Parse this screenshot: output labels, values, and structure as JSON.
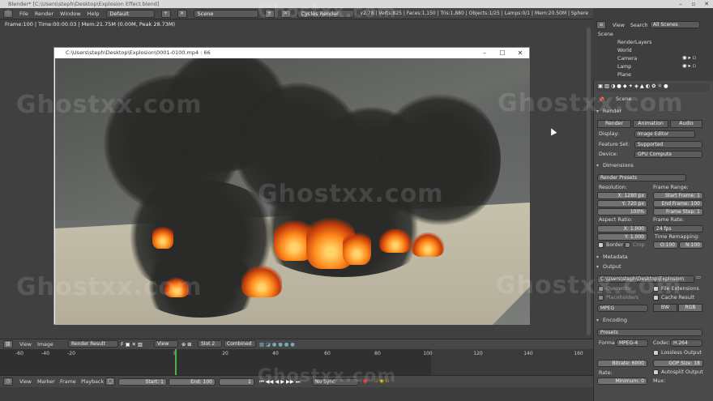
{
  "window": {
    "title": "Blender* [C:\\Users\\steph\\Desktop\\Explosion Effect.blend]"
  },
  "menubar": {
    "items": [
      "File",
      "Render",
      "Window",
      "Help"
    ],
    "layout": "Default",
    "scene": "Scene",
    "engine": "Cycles Render",
    "stats": "v2.78 | Verts:825 | Faces:1,150 | Tris:1,880 | Objects:1/25 | Lamps:0/1 | Mem:20.50M | Sphere"
  },
  "viewport": {
    "info": "Frame:100 | Time:00:00.03 | Mem:21.75M (0.00M, Peak 28.73M)"
  },
  "player": {
    "title": "C:\\Users\\steph\\Desktop\\Explosion\\0001-0100.mp4 :  66"
  },
  "outliner": {
    "view": "View",
    "search": "Search",
    "filter": "All Scenes",
    "rows": [
      "Scene",
      "RenderLayers",
      "World",
      "Camera",
      "Lamp",
      "Plane"
    ]
  },
  "properties": {
    "breadcrumb": "Scene",
    "render": {
      "header": "Render",
      "buttons": [
        "Render",
        "Animation",
        "Audio"
      ],
      "display_label": "Display:",
      "display": "Image Editor",
      "feature_label": "Feature Set:",
      "feature": "Supported",
      "device_label": "Device:",
      "device": "GPU Compute"
    },
    "dimensions": {
      "header": "Dimensions",
      "presets": "Render Presets",
      "resolution_label": "Resolution:",
      "res_x": "X:       1280 px",
      "res_y": "Y:         720 px",
      "res_pct": "100%",
      "frame_range_label": "Frame Range:",
      "start": "Start Frame:      1",
      "end": "End Frame:    100",
      "step": "Frame Step:     1",
      "aspect_label": "Aspect Ratio:",
      "asp_x": "X:         1.000",
      "asp_y": "Y:         1.000",
      "fps_label": "Frame Rate:",
      "fps": "24 fps",
      "remap_label": "Time Remapping:",
      "remap_old": "O:100",
      "remap_new": "N:100",
      "border": "Border",
      "crop": "Crop"
    },
    "metadata": {
      "header": "Metadata"
    },
    "output": {
      "header": "Output",
      "path": "C:\\Users\\steph\\Desktop\\Explosion\\",
      "overwrite": "Overwrite",
      "file_ext": "File Extensions",
      "placeholders": "Placeholders",
      "cache": "Cache Result",
      "format": "MPEG",
      "bw": "BW",
      "rgb": "RGB"
    },
    "encoding": {
      "header": "Encoding",
      "presets": "Presets",
      "format_label": "Forma",
      "format": "MPEG-4",
      "codec_label": "Codec:",
      "codec": "H.264",
      "lossless": "Lossless Output",
      "bitrate": "Bitrate:            6000",
      "gop": "GOP Size:      18",
      "rate_label": "Rate:",
      "autosplit": "Autosplit Output",
      "minimum": "Minimum:        0",
      "mux_label": "Mux:"
    }
  },
  "imageheader": {
    "view": "View",
    "image": "Image",
    "image_name": "Render Result",
    "view2": "View",
    "slot": "Slot 2",
    "pass": "Combined"
  },
  "timeline": {
    "ticks": [
      "-60",
      "-40",
      "-20",
      "0",
      "20",
      "40",
      "60",
      "80",
      "100",
      "120",
      "140",
      "160"
    ]
  },
  "bottombar": {
    "items": [
      "View",
      "Marker",
      "Frame",
      "Playback"
    ],
    "start": "Start:            1",
    "end": "End:             100",
    "current": "1",
    "sync": "No Sync"
  },
  "watermark": "Ghostxx.com"
}
